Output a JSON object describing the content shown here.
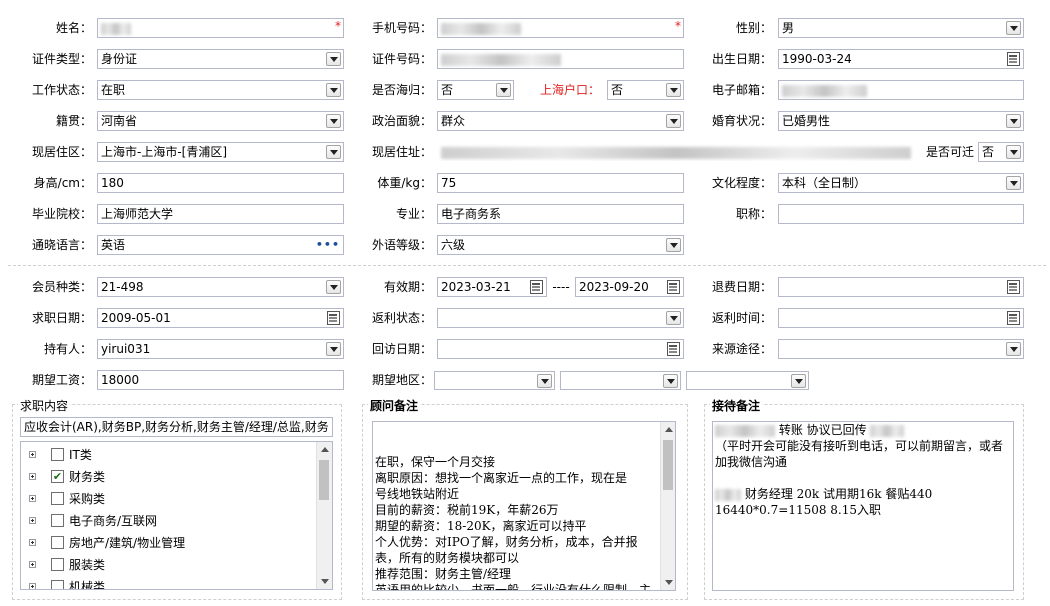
{
  "row1": {
    "name_label": "姓名：",
    "phone_label": "手机号码：",
    "gender_label": "性别：",
    "gender_value": "男",
    "required_mark": "*"
  },
  "row2": {
    "idtype_label": "证件类型：",
    "idtype_value": "身份证",
    "idno_label": "证件号码：",
    "birth_label": "出生日期：",
    "birth_value": "1990-03-24"
  },
  "row3": {
    "work_label": "工作状态：",
    "work_value": "在职",
    "overseas_label": "是否海归：",
    "overseas_value": "否",
    "hukou_label": "上海户口：",
    "hukou_value": "否",
    "email_label": "电子邮箱："
  },
  "row4": {
    "native_label": "籍贯：",
    "native_value": "河南省",
    "political_label": "政治面貌：",
    "political_value": "群众",
    "marital_label": "婚育状况：",
    "marital_value": "已婚男性"
  },
  "row5": {
    "residence_label": "现居住区：",
    "residence_value": "上海市-上海市-[青浦区]",
    "address_label": "现居住址：",
    "relocate_label": "是否可迁",
    "relocate_value": "否"
  },
  "row6": {
    "height_label": "身高/cm：",
    "height_value": "180",
    "weight_label": "体重/kg：",
    "weight_value": "75",
    "edu_label": "文化程度：",
    "edu_value": "本科（全日制）"
  },
  "row7": {
    "school_label": "毕业院校：",
    "school_value": "上海师范大学",
    "major_label": "专业：",
    "major_value": "电子商务系",
    "title_label": "职称：",
    "title_value": ""
  },
  "row8": {
    "lang_label": "通晓语言：",
    "lang_value": "英语",
    "lang_more": "•••",
    "level_label": "外语等级：",
    "level_value": "六级"
  },
  "row9": {
    "member_label": "会员种类：",
    "member_value": "21-498",
    "valid_label": "有效期：",
    "valid_from": "2023-03-21",
    "valid_sep": "----",
    "valid_to": "2023-09-20",
    "refund_label": "退费日期："
  },
  "row10": {
    "jobdate_label": "求职日期：",
    "jobdate_value": "2009-05-01",
    "rebate_label": "返利状态：",
    "rebate_time_label": "返利时间："
  },
  "row11": {
    "holder_label": "持有人：",
    "holder_value": "yirui031",
    "visit_label": "回访日期：",
    "source_label": "来源途径："
  },
  "row12": {
    "salary_label": "期望工资：",
    "salary_value": "18000",
    "area_label": "期望地区："
  },
  "job_content": {
    "title": "求职内容",
    "summary": "应收会计(AR),财务BP,财务分析,财务主管/经理/总监,财务",
    "categories": [
      {
        "label": "IT类",
        "checked": false
      },
      {
        "label": "财务类",
        "checked": true
      },
      {
        "label": "采购类",
        "checked": false
      },
      {
        "label": "电子商务/互联网",
        "checked": false
      },
      {
        "label": "房地产/建筑/物业管理",
        "checked": false
      },
      {
        "label": "服装类",
        "checked": false
      },
      {
        "label": "机械类",
        "checked": false
      }
    ]
  },
  "consultant_notes": {
    "title": "顾问备注",
    "lines": [
      "在职，保守一个月交接",
      "离职原因：想找一个离家近一点的工作，现在是",
      "号线地铁站附近",
      "目前的薪资：税前19K，年薪26万",
      "期望的薪资：18-20K，离家近可以持平",
      "个人优势：对IPO了解，财务分析，成本，合并报",
      "表，所有的财务模块都可以",
      "推荐范围：财务主管/经理",
      "英语用的比较少，书面一般，行业没有什么限制，主"
    ]
  },
  "reception_notes": {
    "title": "接待备注",
    "line1": "转账 协议已回传",
    "line2": "（平时开会可能没有接听到电话，可以前期留言，或者",
    "line3": "加我微信沟通",
    "line4": "财务经理 20k 试用期16k 餐贴440",
    "line5": "16440*0.7=11508   8.15入职"
  },
  "colors": {
    "accent_red": "#e02020",
    "border": "#b5b8c8",
    "link_blue": "#1a4f9b"
  }
}
